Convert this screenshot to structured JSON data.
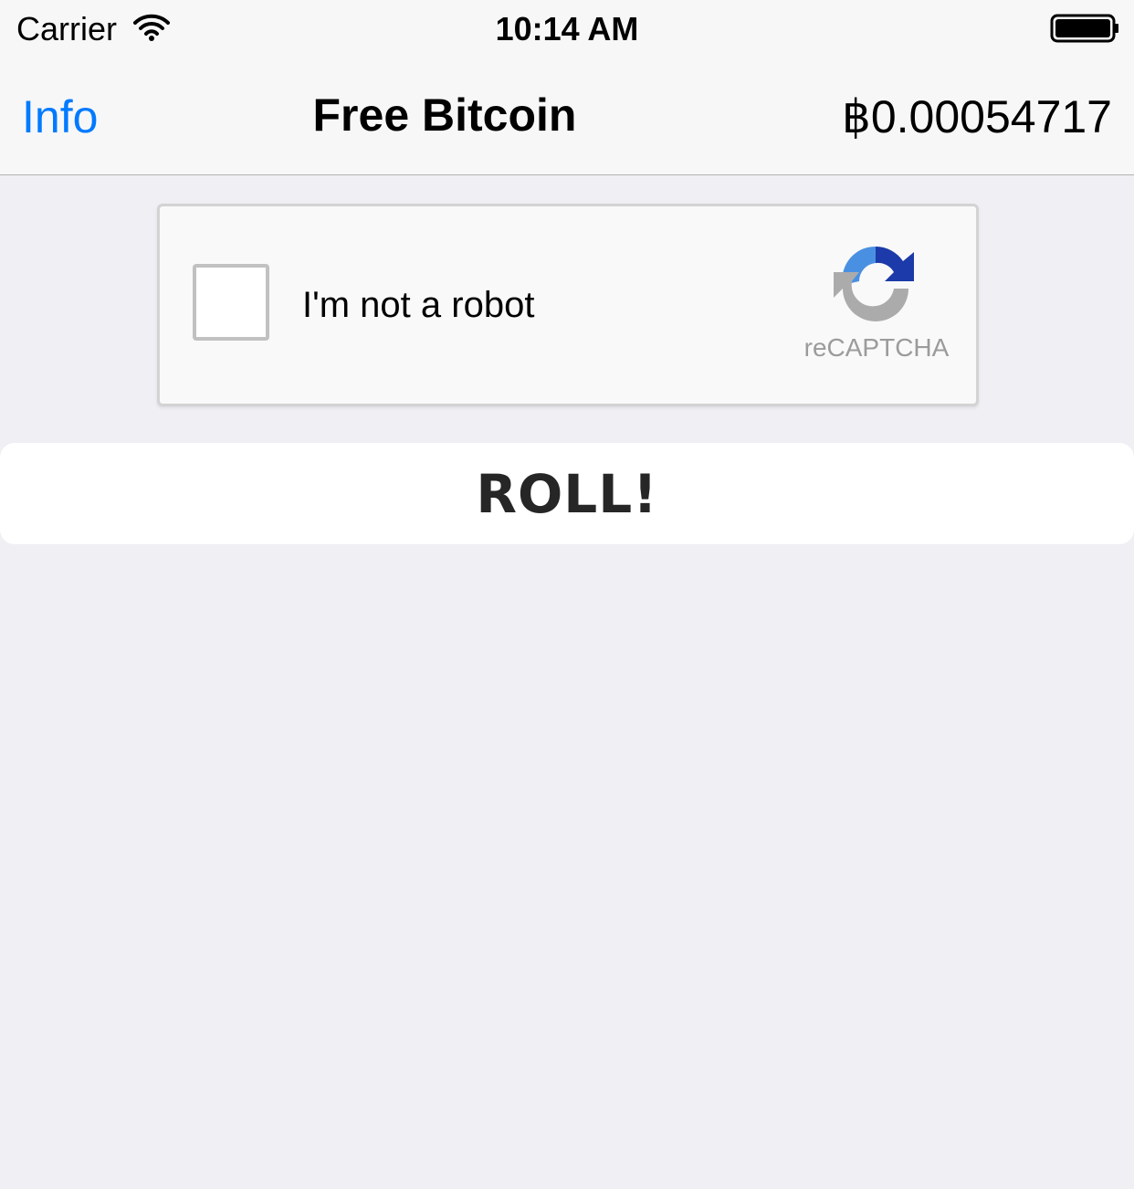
{
  "status_bar": {
    "carrier": "Carrier",
    "time": "10:14 AM",
    "wifi_icon": "wifi-icon",
    "battery_icon": "battery-full-icon"
  },
  "nav": {
    "left_label": "Info",
    "title": "Free Bitcoin",
    "balance": "฿0.00054717"
  },
  "captcha": {
    "label": "I'm not a robot",
    "brand": "reCAPTCHA",
    "checked": false,
    "logo_icon": "recaptcha-logo-icon"
  },
  "action": {
    "roll_label": "ROLL!"
  },
  "colors": {
    "accent": "#007aff",
    "background": "#efeff4",
    "navbar": "#f7f7f7"
  }
}
